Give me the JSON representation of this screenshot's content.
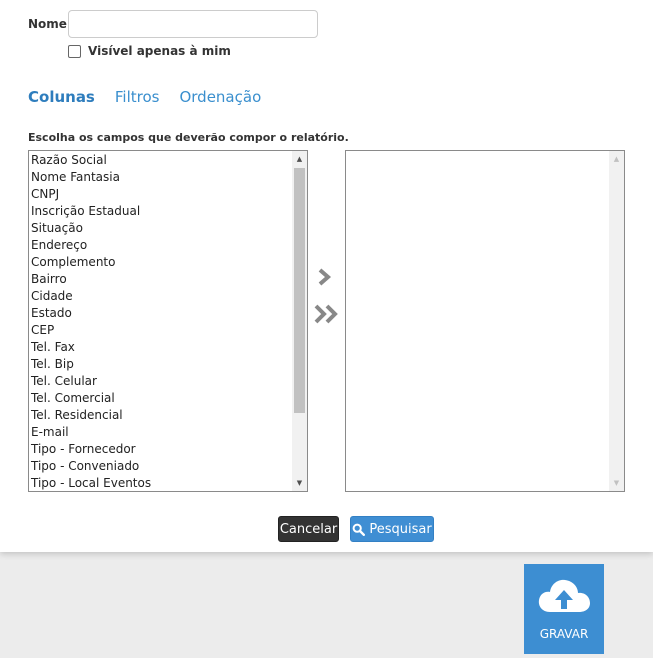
{
  "form": {
    "name_label": "Nome",
    "name_value": "",
    "visible_only_me_label": "Visível apenas à mim"
  },
  "tabs": [
    {
      "label": "Colunas",
      "active": true
    },
    {
      "label": "Filtros",
      "active": false
    },
    {
      "label": "Ordenação",
      "active": false
    }
  ],
  "columns": {
    "instructions": "Escolha os campos que deverão compor o relatório.",
    "available_fields": [
      "Razão Social",
      "Nome Fantasia",
      "CNPJ",
      "Inscrição Estadual",
      "Situação",
      "Endereço",
      "Complemento",
      "Bairro",
      "Cidade",
      "Estado",
      "CEP",
      "Tel. Fax",
      "Tel. Bip",
      "Tel. Celular",
      "Tel. Comercial",
      "Tel. Residencial",
      "E-mail",
      "Tipo - Fornecedor",
      "Tipo - Conveniado",
      "Tipo - Local Eventos"
    ],
    "selected_fields": [],
    "move_one_icon": "chevron-right-icon",
    "move_all_icon": "double-chevron-right-icon"
  },
  "actions": {
    "cancel_label": "Cancelar",
    "search_label": "Pesquisar",
    "search_icon": "search-icon"
  },
  "save": {
    "label": "GRAVAR",
    "icon": "cloud-upload-icon"
  },
  "colors": {
    "accent": "#3d8ed2",
    "tab_active": "#2e7dbd",
    "cancel_bg": "#333333",
    "background": "#ececec"
  }
}
